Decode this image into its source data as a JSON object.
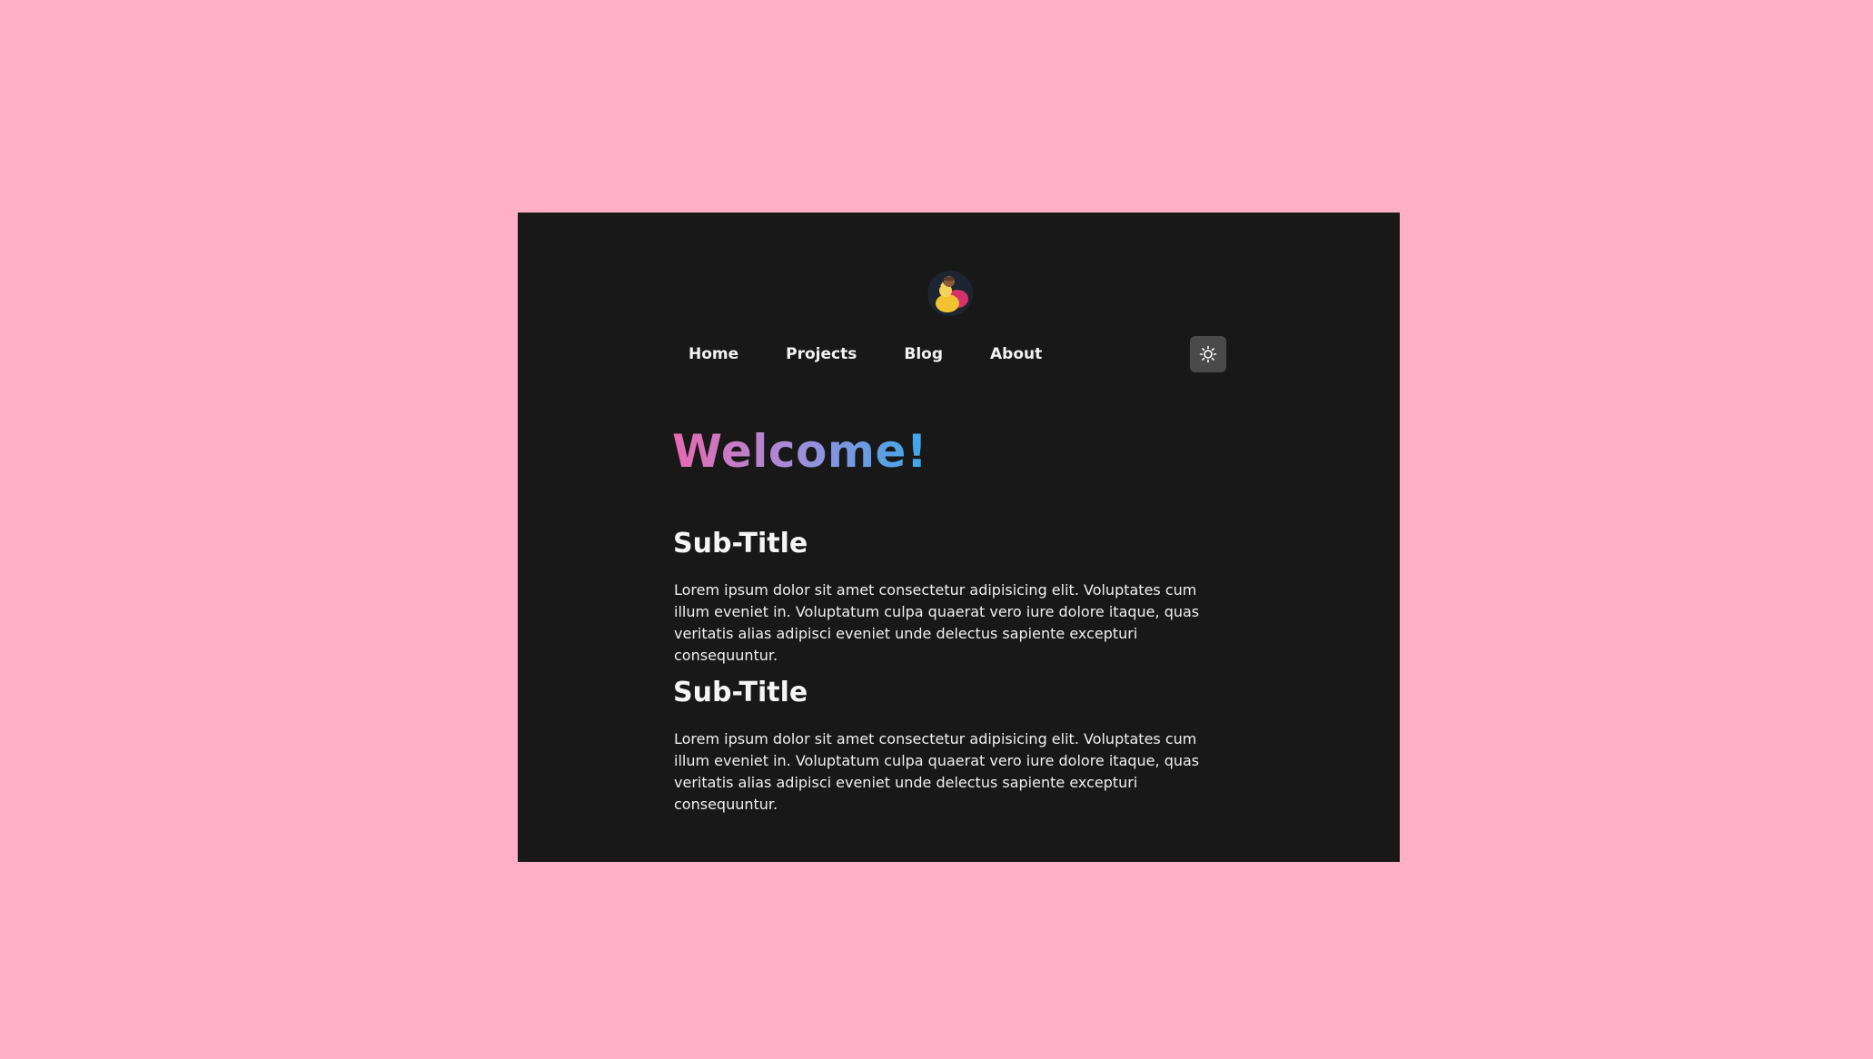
{
  "nav": {
    "items": [
      {
        "label": "Home"
      },
      {
        "label": "Projects"
      },
      {
        "label": "Blog"
      },
      {
        "label": "About"
      }
    ]
  },
  "icons": {
    "avatar": "avatar-illustration",
    "theme_toggle": "sun-icon"
  },
  "hero": {
    "title": "Welcome!"
  },
  "sections": [
    {
      "title": "Sub-Title",
      "body": "Lorem ipsum dolor sit amet consectetur adipisicing elit. Voluptates cum illum eveniet in. Voluptatum culpa quaerat vero iure dolore itaque, quas veritatis alias adipisci eveniet unde delectus sapiente excepturi consequuntur."
    },
    {
      "title": "Sub-Title",
      "body": "Lorem ipsum dolor sit amet consectetur adipisicing elit. Voluptates cum illum eveniet in. Voluptatum culpa quaerat vero iure dolore itaque, quas veritatis alias adipisci eveniet unde delectus sapiente excepturi consequuntur."
    }
  ],
  "colors": {
    "page_background": "#ffafc8",
    "window_background": "#181818",
    "text": "#f5f5f5",
    "toggle_background": "#4a4a4a",
    "gradient_start": "#e76ab0",
    "gradient_mid": "#a98ad8",
    "gradient_end": "#3aa9ea"
  }
}
